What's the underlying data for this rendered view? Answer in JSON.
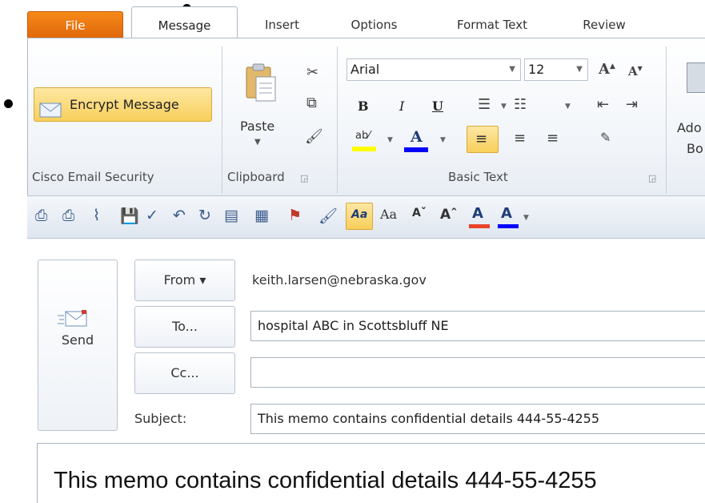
{
  "ribbon_tabs": [
    "File",
    "Message",
    "Insert",
    "Options",
    "Format Text",
    "Review"
  ],
  "groups": {
    "cisco": {
      "label": "Cisco Email Security",
      "encrypt_label": "Encrypt Message"
    },
    "clipboard": {
      "label": "Clipboard",
      "paste_label": "Paste"
    },
    "basic_text": {
      "label": "Basic Text",
      "font_name": "Arial",
      "font_size": "12"
    },
    "names": {
      "partial_label_1": "Ado",
      "partial_label_2": "Bo"
    }
  },
  "compose": {
    "send_label": "Send",
    "from_label": "From ▾",
    "from_value": "keith.larsen@nebraska.gov",
    "to_label": "To...",
    "to_value": "hospital ABC in Scottsbluff NE",
    "cc_label": "Cc...",
    "cc_value": "",
    "subject_label": "Subject:",
    "subject_value": "This memo contains confidential details 444-55-4255",
    "body_text": "This memo contains confidential details 444-55-4255"
  },
  "colors": {
    "file_tab": "#e8740f",
    "highlight": "#f8cf5a",
    "font_color_bar": "#0000ff",
    "highlight_bar": "#ffff00"
  }
}
